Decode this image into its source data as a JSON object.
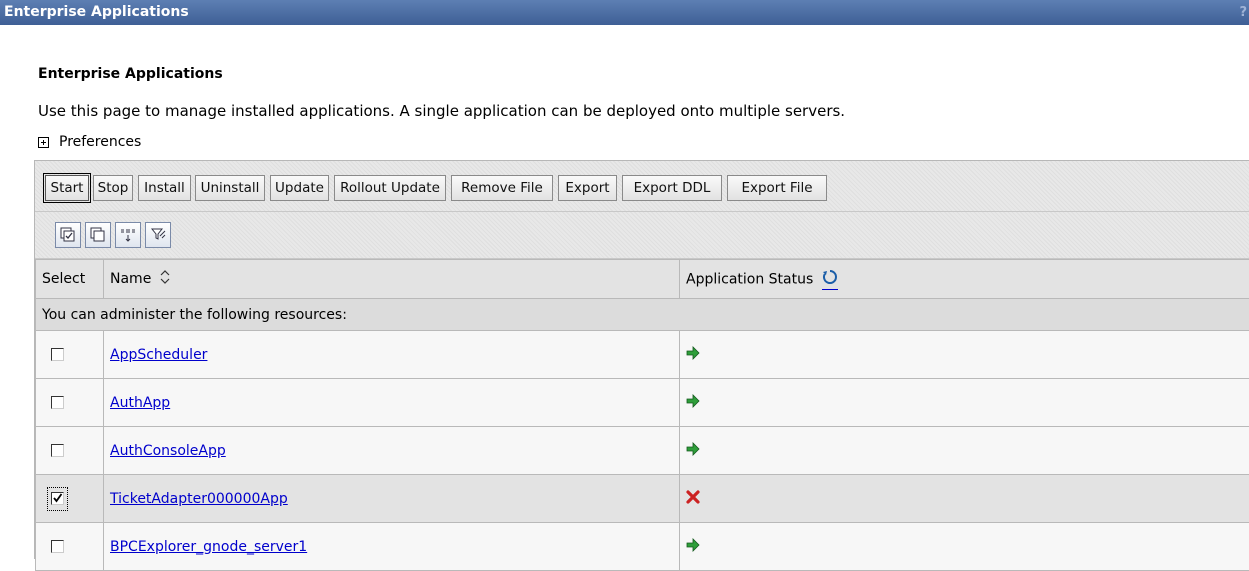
{
  "window": {
    "title": "Enterprise Applications",
    "help_label": "?"
  },
  "page": {
    "heading": "Enterprise Applications",
    "description": "Use this page to manage installed applications. A single application can be deployed onto multiple servers.",
    "preferences_label": "Preferences"
  },
  "toolbar": {
    "buttons": [
      "Start",
      "Stop",
      "Install",
      "Uninstall",
      "Update",
      "Rollout Update",
      "Remove File",
      "Export",
      "Export DDL",
      "Export File"
    ]
  },
  "table": {
    "columns": {
      "select": "Select",
      "name": "Name",
      "status": "Application Status"
    },
    "group_label": "You can administer the following resources:",
    "rows": [
      {
        "name": "AppScheduler",
        "checked": false,
        "status": "started"
      },
      {
        "name": "AuthApp",
        "checked": false,
        "status": "started"
      },
      {
        "name": "AuthConsoleApp",
        "checked": false,
        "status": "started"
      },
      {
        "name": "TicketAdapter000000App",
        "checked": true,
        "status": "stopped"
      },
      {
        "name": "BPCExplorer_gnode_server1",
        "checked": false,
        "status": "started"
      }
    ]
  },
  "colors": {
    "title_bar": "#4a6aa0",
    "link": "#0000cc",
    "started": "#2e9e3a",
    "stopped": "#cc2222"
  }
}
